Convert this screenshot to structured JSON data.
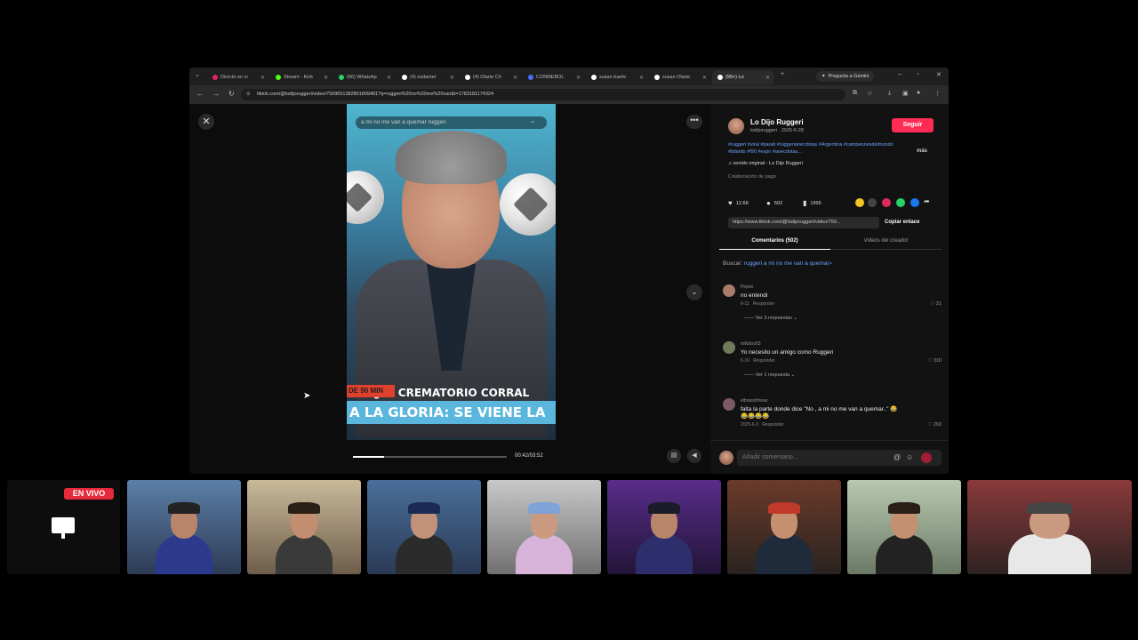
{
  "browser": {
    "tabs": [
      {
        "label": "Directo en ci",
        "color": "#e0245e"
      },
      {
        "label": "Stream - Kick",
        "color": "#53fc18"
      },
      {
        "label": "(66) WhatsAp",
        "color": "#25d366"
      },
      {
        "label": "(4) sudamer",
        "color": "#ffffff"
      },
      {
        "label": "(4) Olarte Ch",
        "color": "#ffffff"
      },
      {
        "label": "CONMEBOL",
        "color": "#4a6cf7"
      },
      {
        "label": "susan.fuarte",
        "color": "#ffffff"
      },
      {
        "label": "susan Olarte",
        "color": "#ffffff"
      },
      {
        "label": "(99+) Lo",
        "color": "#ffffff"
      }
    ],
    "new_tab": "+",
    "gemini_label": "Pregunta a Gemini",
    "url": "tiktok.com/@lodijoruggeri/video/7509651382801899481?q=ruggeri%20no%20me%20van&t=1783181174324"
  },
  "video": {
    "search_text": "a mi no me van a quemar ruggeri",
    "caption_top": "¿AL CREMATORIO CORRAL",
    "caption_tag": "DE 90 MIN",
    "caption_bottom": "A LA GLORIA: SE VIENE LA",
    "progress": 0.2,
    "time": "00:42/03:52"
  },
  "post": {
    "author": "Lo Dijo Ruggeri",
    "handle": "lodijoruggeri · 2025-5-28",
    "follow_label": "Seguir",
    "description": "#ruggeri #viral #parati #ruggerianecdotas #Argentina #campeonesdelmundo #bilardo #f90 #espn #anecdotas...",
    "more_label": "más",
    "sound": "sonido original - Lo Dijo Ruggeri",
    "collab": "Colaboración de pago",
    "likes": "12.6K",
    "comments": "502",
    "saves": "1995",
    "link": "https://www.tiktok.com/@lodijoruggeri/video/750...",
    "copy_label": "Copiar enlace",
    "tab_comments": "Comentarios (502)",
    "tab_creator": "Videos del creador",
    "search_prefix": "Buscar:",
    "search_query": "ruggeri a mi no me van a quemar"
  },
  "comments": [
    {
      "user": "Pirpon",
      "text": "no entendi",
      "date": "6-11",
      "reply": "Responder",
      "likes": "21",
      "replies": "Ver 3 respuestas"
    },
    {
      "user": "rollcitos03",
      "text": "Yo necesito un amigo como Ruggeri",
      "date": "6-16",
      "reply": "Responder",
      "likes": "310",
      "replies": "Ver 1 respuesta"
    },
    {
      "user": "elbrasorfireas",
      "text": "falta la parte donde dice \"No , a mi no me van a quemar..\" 😂😂😂😂😂",
      "date": "2025-6-3",
      "reply": "Responder",
      "likes": "269",
      "replies": ""
    }
  ],
  "comment_bar": {
    "placeholder": "Añadir comentario..."
  },
  "stream": {
    "live_label": "EN VIVO"
  },
  "colors": {
    "accent": "#fe2c55",
    "live": "#e6293b",
    "link": "#6aa3ff"
  }
}
